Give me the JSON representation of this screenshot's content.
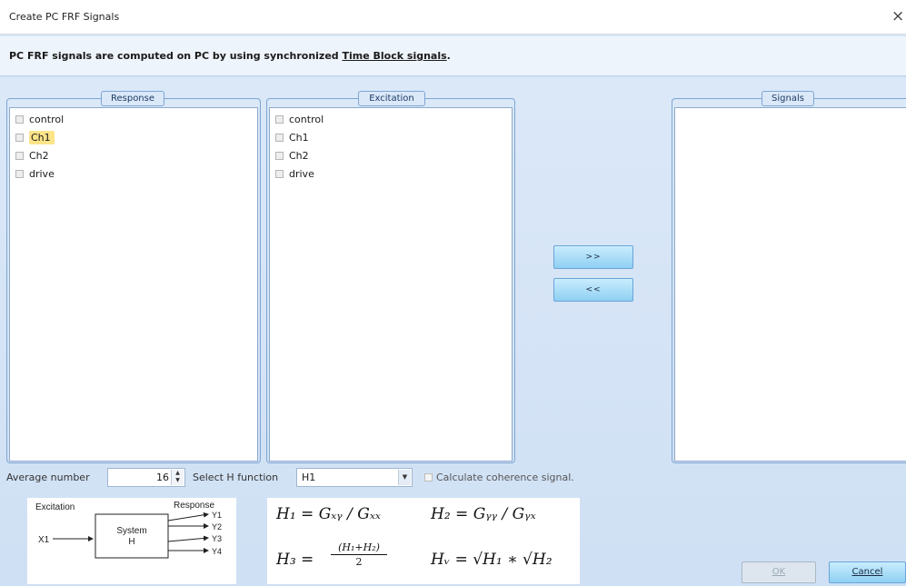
{
  "window": {
    "title": "Create PC FRF Signals",
    "close_glyph": "×"
  },
  "info": {
    "prefix": "PC FRF signals are computed on PC by using synchronized",
    "link": "Time Block signals",
    "suffix": "."
  },
  "response": {
    "legend": "Response",
    "items": [
      {
        "label": "control",
        "selected": false
      },
      {
        "label": "Ch1",
        "selected": true
      },
      {
        "label": "Ch2",
        "selected": false
      },
      {
        "label": "drive",
        "selected": false
      }
    ]
  },
  "excitation": {
    "legend": "Excitation",
    "items": [
      {
        "label": "control"
      },
      {
        "label": "Ch1"
      },
      {
        "label": "Ch2"
      },
      {
        "label": "drive"
      }
    ]
  },
  "signals": {
    "legend": "Signals",
    "items": []
  },
  "buttons": {
    "add": ">>",
    "remove": "<<",
    "ok": "OK",
    "cancel": "Cancel"
  },
  "params": {
    "average_label": "Average number",
    "average_value": "16",
    "h_function_label": "Select H function",
    "h_function_value": "H1",
    "coherence_label": "Calculate coherence signal."
  },
  "diagram": {
    "excitation": "Excitation",
    "response": "Response",
    "input": "X1",
    "system_line1": "System",
    "system_line2": "H",
    "outputs": [
      "Y1",
      "Y2",
      "Y3",
      "Y4"
    ]
  },
  "formulas": {
    "h1": "H₁ = Gₓᵧ / Gₓₓ",
    "h2": "H₂ = Gᵧᵧ / Gᵧₓ",
    "h3_lhs": "H₃ =",
    "h3_num": "(H₁+H₂)",
    "h3_den": "2",
    "hv": "Hᵥ = √H₁ ∗ √H₂"
  }
}
